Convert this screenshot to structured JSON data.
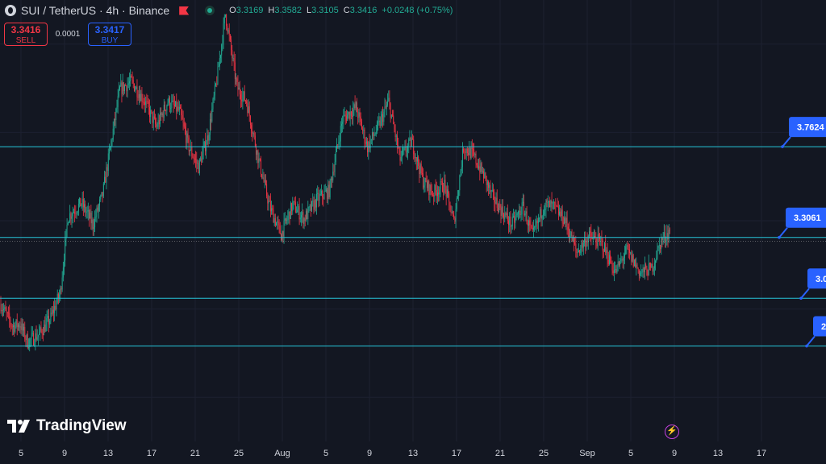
{
  "header": {
    "symbol": "SUI / TetherUS · 4h · Binance",
    "ohlc": [
      {
        "k": "O",
        "v": "3.3169"
      },
      {
        "k": "H",
        "v": "3.3582"
      },
      {
        "k": "L",
        "v": "3.3105"
      },
      {
        "k": "C",
        "v": "3.3416"
      },
      {
        "k": "",
        "v": "+0.0248 (+0.75%)"
      }
    ]
  },
  "trade": {
    "sell_price": "3.3416",
    "sell_label": "SELL",
    "spread": "0.0001",
    "buy_price": "3.3417",
    "buy_label": "BUY"
  },
  "brand": "TradingView",
  "colors": {
    "background": "#131722",
    "up": "#22ab94",
    "down": "#f23645",
    "level_line": "#26c6da",
    "label": "#2962ff",
    "text": "#d1d4dc"
  },
  "chart_data": {
    "type": "candlestick",
    "interval": "4h",
    "ylim": [
      2.28,
      4.5
    ],
    "x_tick_labels": [
      "5",
      "9",
      "13",
      "17",
      "21",
      "25",
      "Aug",
      "5",
      "9",
      "13",
      "17",
      "21",
      "25",
      "Sep",
      "5",
      "9",
      "13",
      "17"
    ],
    "anchors": [
      [
        0,
        2.97
      ],
      [
        12,
        2.86
      ],
      [
        20,
        2.87
      ],
      [
        28,
        2.78
      ],
      [
        40,
        2.82
      ],
      [
        52,
        2.9
      ],
      [
        62,
        3.03
      ],
      [
        70,
        3.41
      ],
      [
        84,
        3.48
      ],
      [
        96,
        3.37
      ],
      [
        106,
        3.52
      ],
      [
        124,
        4.05
      ],
      [
        136,
        4.09
      ],
      [
        150,
        3.99
      ],
      [
        162,
        3.86
      ],
      [
        174,
        3.99
      ],
      [
        186,
        3.94
      ],
      [
        196,
        3.76
      ],
      [
        206,
        3.66
      ],
      [
        216,
        3.82
      ],
      [
        226,
        4.13
      ],
      [
        234,
        4.43
      ],
      [
        246,
        4.06
      ],
      [
        256,
        3.99
      ],
      [
        268,
        3.71
      ],
      [
        280,
        3.46
      ],
      [
        292,
        3.32
      ],
      [
        304,
        3.47
      ],
      [
        316,
        3.4
      ],
      [
        330,
        3.5
      ],
      [
        342,
        3.54
      ],
      [
        356,
        3.9
      ],
      [
        370,
        3.96
      ],
      [
        382,
        3.76
      ],
      [
        394,
        3.87
      ],
      [
        404,
        3.99
      ],
      [
        416,
        3.7
      ],
      [
        428,
        3.79
      ],
      [
        440,
        3.59
      ],
      [
        450,
        3.53
      ],
      [
        462,
        3.57
      ],
      [
        472,
        3.38
      ],
      [
        482,
        3.76
      ],
      [
        492,
        3.72
      ],
      [
        504,
        3.61
      ],
      [
        512,
        3.51
      ],
      [
        522,
        3.44
      ],
      [
        532,
        3.37
      ],
      [
        544,
        3.46
      ],
      [
        554,
        3.31
      ],
      [
        566,
        3.47
      ],
      [
        576,
        3.46
      ],
      [
        588,
        3.39
      ],
      [
        600,
        3.23
      ],
      [
        612,
        3.31
      ],
      [
        626,
        3.28
      ],
      [
        640,
        3.13
      ],
      [
        652,
        3.24
      ],
      [
        666,
        3.13
      ],
      [
        678,
        3.15
      ],
      [
        688,
        3.29
      ],
      [
        697,
        3.34
      ]
    ],
    "levels": [
      {
        "value": 3.7624,
        "label": "3.7624"
      },
      {
        "value": 3.3061,
        "label": "3.3061"
      },
      {
        "value": 3.0,
        "label": "3.0"
      },
      {
        "value": 2.76,
        "label": "2"
      }
    ],
    "last_price": 3.3416
  }
}
